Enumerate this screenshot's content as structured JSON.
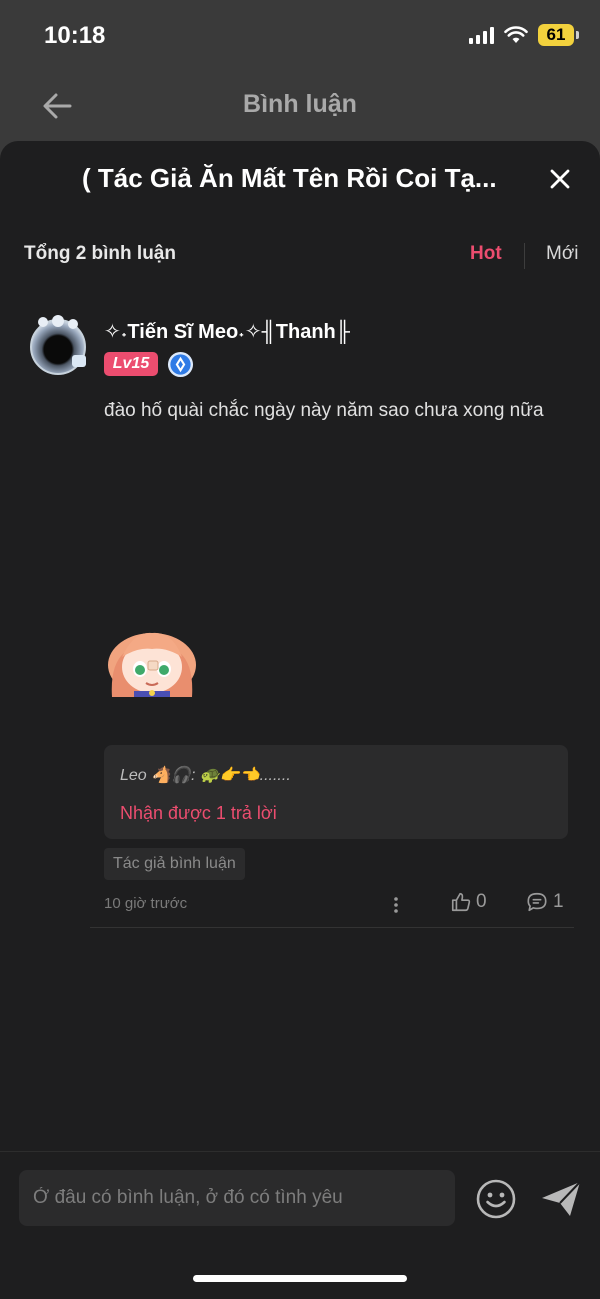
{
  "status": {
    "time": "10:18",
    "battery": "61"
  },
  "nav": {
    "title": "Bình luận"
  },
  "sheet": {
    "title": "( Tác Giả Ăn Mất Tên Rồi Coi Tạ...",
    "total_comments": "Tổng 2 bình luận",
    "sort_hot": "Hot",
    "sort_new": "Mới",
    "accent_color": "#ec4d6f"
  },
  "comment": {
    "username": "✧˖Tiến Sĩ Meo˖✧╢Thanh╟",
    "level": "Lv15",
    "text": "đào hố quài chắc ngày này năm sao chưa xong nữa",
    "reply_preview": "Leo 🐴🎧: 🐢👉👈.......",
    "reply_count_text": "Nhận được 1 trả lời",
    "author_tag": "Tác giả bình luận",
    "timestamp": "10 giờ trước",
    "likes": "0",
    "replies": "1"
  },
  "input": {
    "placeholder": "Ở đâu có bình luận, ở đó có tình yêu"
  },
  "icons": {
    "back": "arrow-left-icon",
    "close": "close-icon",
    "verify": "verified-badge-icon",
    "more": "more-vertical-icon",
    "like": "thumbs-up-icon",
    "reply": "comment-bubble-icon",
    "emoji": "smiley-icon",
    "send": "send-icon"
  }
}
